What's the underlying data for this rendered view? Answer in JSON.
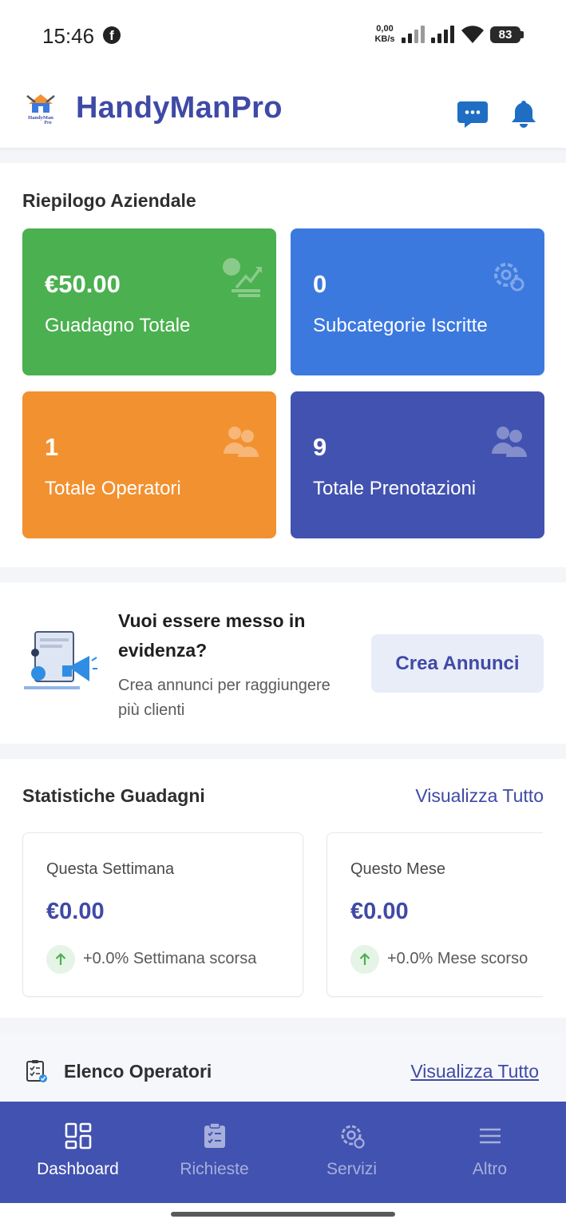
{
  "status_bar": {
    "time": "15:46",
    "net_speed_value": "0,00",
    "net_speed_unit": "KB/s",
    "battery": "83"
  },
  "header": {
    "title": "HandyManPro",
    "logo_text": "HandyMan Pro"
  },
  "summary": {
    "title": "Riepilogo Aziendale",
    "cards": [
      {
        "value": "€50.00",
        "label": "Guadagno Totale",
        "color": "#4bb04f",
        "icon": "money-growth-icon"
      },
      {
        "value": "0",
        "label": "Subcategorie Iscritte",
        "color": "#3c79df",
        "icon": "gear-icon"
      },
      {
        "value": "1",
        "label": "Totale Operatori",
        "color": "#f29130",
        "icon": "users-icon"
      },
      {
        "value": "9",
        "label": "Totale Prenotazioni",
        "color": "#4252b0",
        "icon": "users-icon"
      }
    ]
  },
  "promo": {
    "heading": "Vuoi essere messo in evidenza?",
    "description": "Crea annunci per raggiungere più clienti",
    "button_label": "Crea Annunci"
  },
  "earnings": {
    "title": "Statistiche Guadagni",
    "view_all": "Visualizza Tutto",
    "cards": [
      {
        "period": "Questa Settimana",
        "amount": "€0.00",
        "trend": "+0.0% Settimana scorsa"
      },
      {
        "period": "Questo Mese",
        "amount": "€0.00",
        "trend": "+0.0% Mese scorso"
      }
    ]
  },
  "operators": {
    "title": "Elenco Operatori",
    "view_all": "Visualizza Tutto"
  },
  "nav": {
    "items": [
      {
        "label": "Dashboard",
        "icon": "dashboard-icon",
        "active": true
      },
      {
        "label": "Richieste",
        "icon": "clipboard-icon",
        "active": false
      },
      {
        "label": "Servizi",
        "icon": "gear-icon",
        "active": false
      },
      {
        "label": "Altro",
        "icon": "menu-icon",
        "active": false
      }
    ]
  },
  "colors": {
    "brand": "#3f4aa6",
    "nav_background": "#4252b0",
    "trend_up": "#4bb04f"
  }
}
